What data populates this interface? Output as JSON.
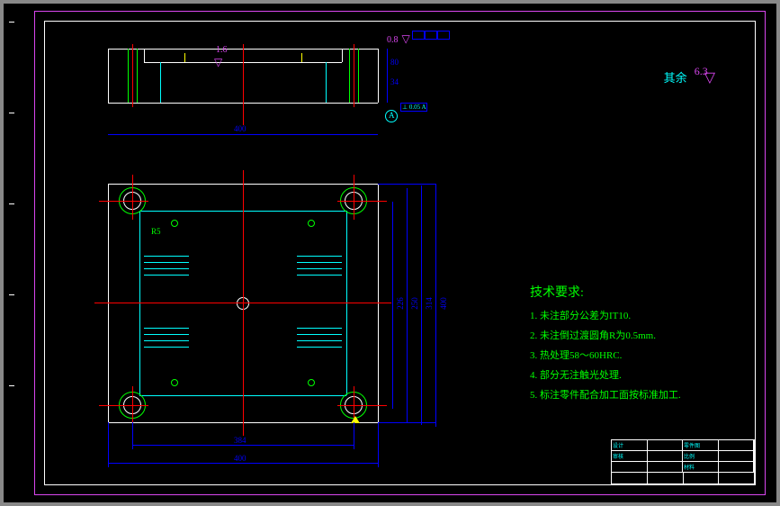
{
  "canvas": {
    "bg": "#000000"
  },
  "colors": {
    "frame": "#d946ef",
    "border": "#ffffff",
    "center": "#ff0000",
    "hole": "#00ff00",
    "hidden": "#00ffff",
    "dim": "#0000ff",
    "text_req": "#00ff00",
    "roughness": "#d946ef"
  },
  "top_view": {
    "width_label": "400",
    "roughness_1": "1.6",
    "roughness_top": "0.8",
    "dim_right_1": "80",
    "dim_right_2": "34",
    "tol_box": "⊥ 0.05 A",
    "gdt_label": "A"
  },
  "plan_view": {
    "width_label": "400",
    "dim_1": "384",
    "dim_r1": "226",
    "dim_r2": "250",
    "dim_r3": "314",
    "dim_r4": "400",
    "hole_label": "R5"
  },
  "surface_finish": {
    "label": "其余",
    "value": "6.3"
  },
  "tech_req": {
    "title": "技术要求:",
    "items": [
      "1. 未注部分公差为IT10.",
      "2. 未注倒过渡圆角R为0.5mm.",
      "3. 热处理58～60HRC.",
      "4. 部分无注触光处理.",
      "5. 标注零件配合加工面按标准加工."
    ]
  },
  "titleblock": {
    "part": "零件图",
    "scale": "比例",
    "material": "材料",
    "drawn": "设计",
    "check": "审核"
  },
  "symbols": {
    "surface_marks": [
      "▽",
      "▽"
    ],
    "datum": "A"
  }
}
